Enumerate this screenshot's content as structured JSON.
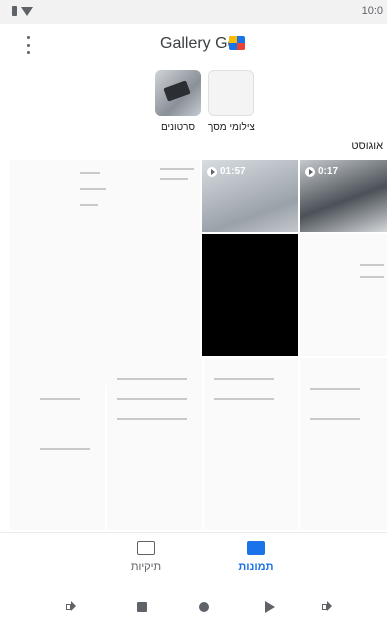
{
  "status_bar": {
    "time": "10:0"
  },
  "app_bar": {
    "title": "Gallery Go",
    "menu_icon": "more-vert-icon",
    "logo_icon": "gallery-go-logo-icon"
  },
  "folders": [
    {
      "label": "צילומי מסך",
      "icon": "folder-thumbnail"
    },
    {
      "label": "סרטונים",
      "icon": "folder-thumbnail"
    }
  ],
  "section": {
    "title": "אוגוסט"
  },
  "media": [
    {
      "type": "screenshot"
    },
    {
      "type": "video",
      "duration": "01:57"
    },
    {
      "type": "video",
      "duration": "0:17"
    },
    {
      "type": "screenshot"
    },
    {
      "type": "dark"
    },
    {
      "type": "screenshot"
    },
    {
      "type": "screenshot"
    },
    {
      "type": "screenshot"
    },
    {
      "type": "screenshot"
    }
  ],
  "bottom_nav": {
    "folders_label": "תיקיות",
    "photos_label": "תמונות",
    "active": "photos"
  },
  "system_nav": [
    "volume-down-icon",
    "recents-icon",
    "home-icon",
    "back-icon",
    "volume-up-icon"
  ],
  "colors": {
    "accent": "#1a73e8",
    "icon_gray": "#5f6368"
  }
}
